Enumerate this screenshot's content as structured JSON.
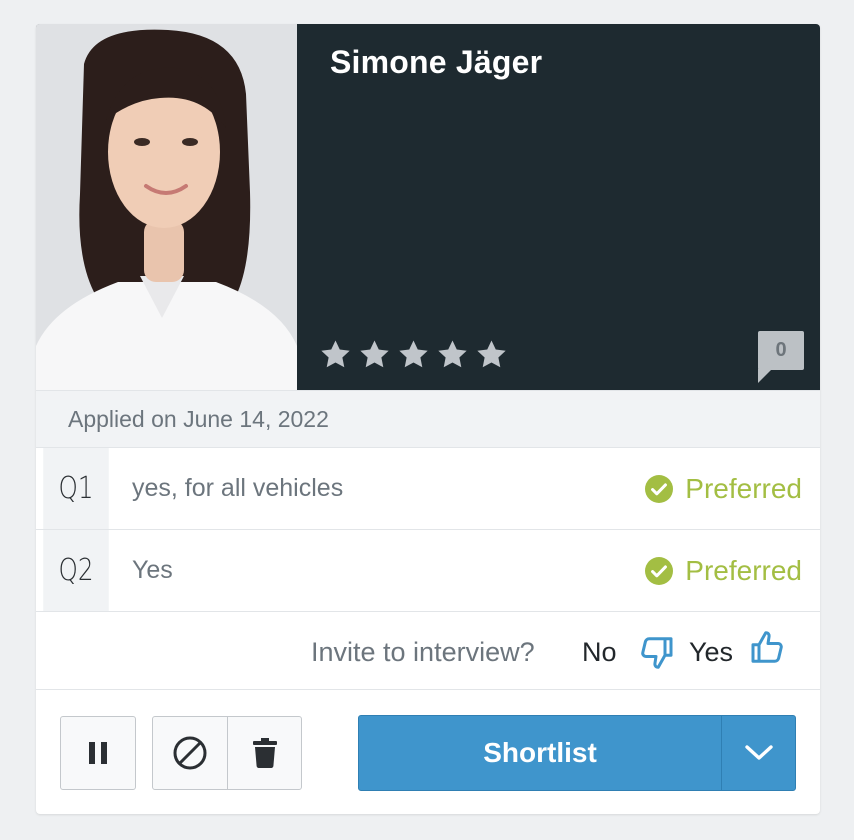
{
  "candidate": {
    "name": "Simone Jäger",
    "rating": 0,
    "max_rating": 5,
    "comment_count": "0",
    "applied_text": "Applied on June 14, 2022"
  },
  "questions": [
    {
      "label": "Q1",
      "answer": "yes, for all vehicles",
      "status": "Preferred"
    },
    {
      "label": "Q2",
      "answer": "Yes",
      "status": "Preferred"
    }
  ],
  "invite": {
    "question": "Invite to interview?",
    "no_label": "No",
    "yes_label": "Yes"
  },
  "actions": {
    "pause_icon": "pause-icon",
    "reject_icon": "ban-icon",
    "delete_icon": "trash-icon",
    "shortlist_label": "Shortlist",
    "dropdown_icon": "chevron-down-icon"
  },
  "colors": {
    "header_bg": "#1e2a30",
    "preferred": "#a3be43",
    "primary": "#3f95cc",
    "thumb": "#3f95cc",
    "star": "#c0c5ca"
  }
}
